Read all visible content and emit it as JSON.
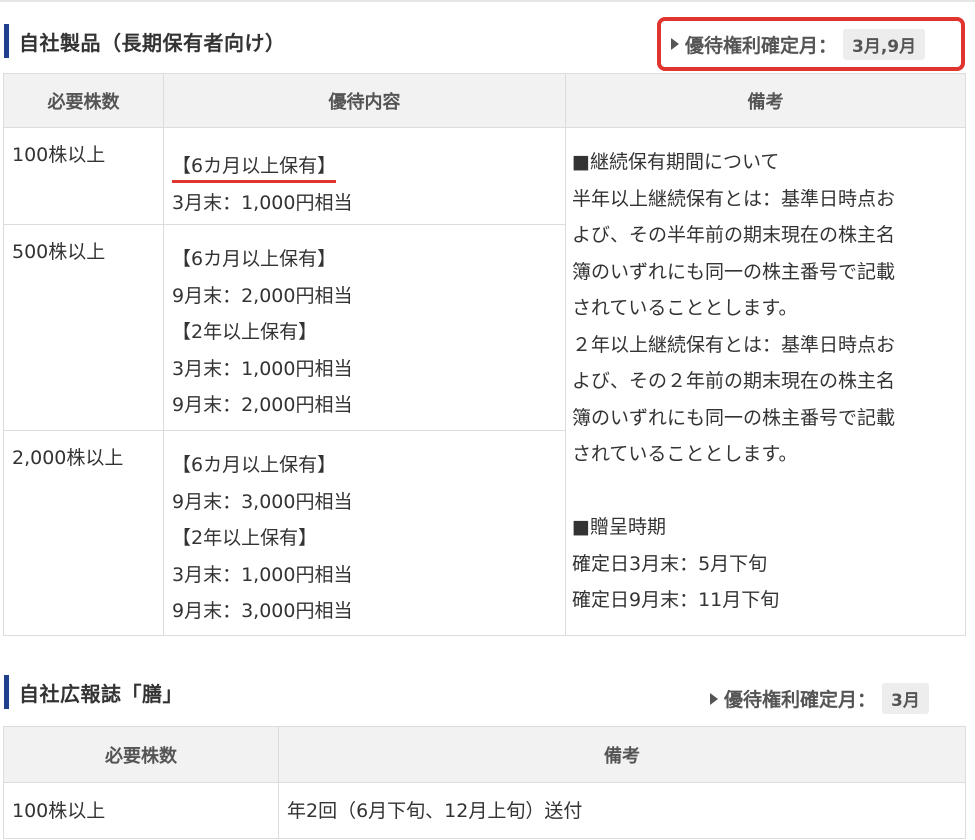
{
  "sections": [
    {
      "title": "自社製品（長期保有者向け）",
      "confirm_label": "優待権利確定月：",
      "confirm_value": "3月,9月",
      "headers": [
        "必要株数",
        "優待内容",
        "備考"
      ],
      "rows": [
        {
          "qty": "100株以上",
          "benefit": [
            "【6カ月以上保有】",
            "3月末：1,000円相当"
          ]
        },
        {
          "qty": "500株以上",
          "benefit": [
            "【6カ月以上保有】",
            "9月末：2,000円相当",
            "【2年以上保有】",
            "3月末：1,000円相当",
            "9月末：2,000円相当"
          ]
        },
        {
          "qty": "2,000株以上",
          "benefit": [
            "【6カ月以上保有】",
            "9月末：3,000円相当",
            "【2年以上保有】",
            "3月末：1,000円相当",
            "9月末：3,000円相当"
          ]
        }
      ],
      "note": [
        "■継続保有期間について",
        "半年以上継続保有とは：基準日時点お",
        "よび、その半年前の期末現在の株主名",
        "簿のいずれにも同一の株主番号で記載",
        "されていることとします。",
        "２年以上継続保有とは：基準日時点お",
        "よび、その２年前の期末現在の株主名",
        "簿のいずれにも同一の株主番号で記載",
        "されていることとします。",
        "",
        "■贈呈時期",
        "確定日3月末：5月下旬",
        "確定日9月末：11月下旬"
      ]
    },
    {
      "title": "自社広報誌「膳」",
      "confirm_label": "優待権利確定月：",
      "confirm_value": "3月",
      "headers": [
        "必要株数",
        "備考"
      ],
      "rows": [
        {
          "qty": "100株以上",
          "note": "年2回（6月下旬、12月上旬）送付"
        }
      ]
    }
  ],
  "colors": {
    "title_bar": "#1f3f8f",
    "highlight": "#e0352f",
    "header_bg": "#f2f2f2",
    "badge_bg": "#ededed"
  }
}
